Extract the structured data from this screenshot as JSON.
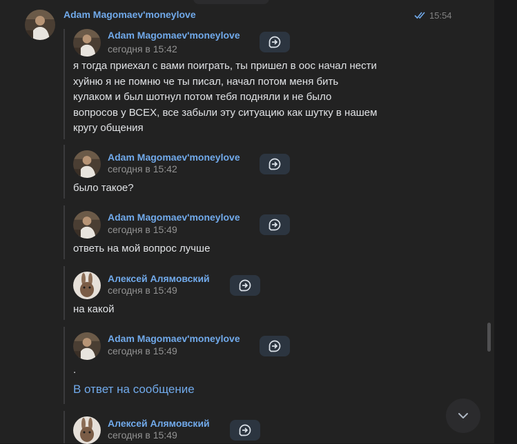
{
  "message": {
    "sender": "Adam Magomaev'moneylove",
    "time": "15:54",
    "status_icon": "double-check-icon"
  },
  "forwarded": [
    {
      "author": "Adam Magomaev'moneylove",
      "date": "сегодня в 15:42",
      "avatar": "man-avatar",
      "text_lines": [
        "я тогда приехал с вами поиграть, ты пришел в оос начал нести",
        "хуйню я не помню че ты писал, начал потом меня бить",
        "кулаком и был шотнул потом тебя подняли и не было",
        "вопросов у ВСЕХ, все забыли эту ситуацию как шутку в нашем",
        "кругу общения"
      ]
    },
    {
      "author": "Adam Magomaev'moneylove",
      "date": "сегодня в 15:42",
      "avatar": "man-avatar",
      "text_lines": [
        "было такое?"
      ]
    },
    {
      "author": "Adam Magomaev'moneylove",
      "date": "сегодня в 15:49",
      "avatar": "man-avatar",
      "text_lines": [
        "ответь на мой вопрос лучше"
      ]
    },
    {
      "author": "Алексей Алямовский",
      "date": "сегодня в 15:49",
      "avatar": "rabbit-avatar",
      "text_lines": [
        "на какой"
      ]
    },
    {
      "author": "Adam Magomaev'moneylove",
      "date": "сегодня в 15:49",
      "avatar": "man-avatar",
      "text_lines": [
        "."
      ],
      "reply_link": "В ответ на сообщение"
    },
    {
      "author": "Алексей Алямовский",
      "date": "сегодня в 15:49",
      "avatar": "rabbit-avatar",
      "text_lines": []
    }
  ],
  "icons": {
    "go_to_message": "go-to-message-icon",
    "scroll_down": "chevron-down-icon"
  },
  "colors": {
    "background": "#222222",
    "link": "#71aaeb",
    "text": "#e1e3e6",
    "muted": "#939393",
    "button": "#2c3540"
  }
}
